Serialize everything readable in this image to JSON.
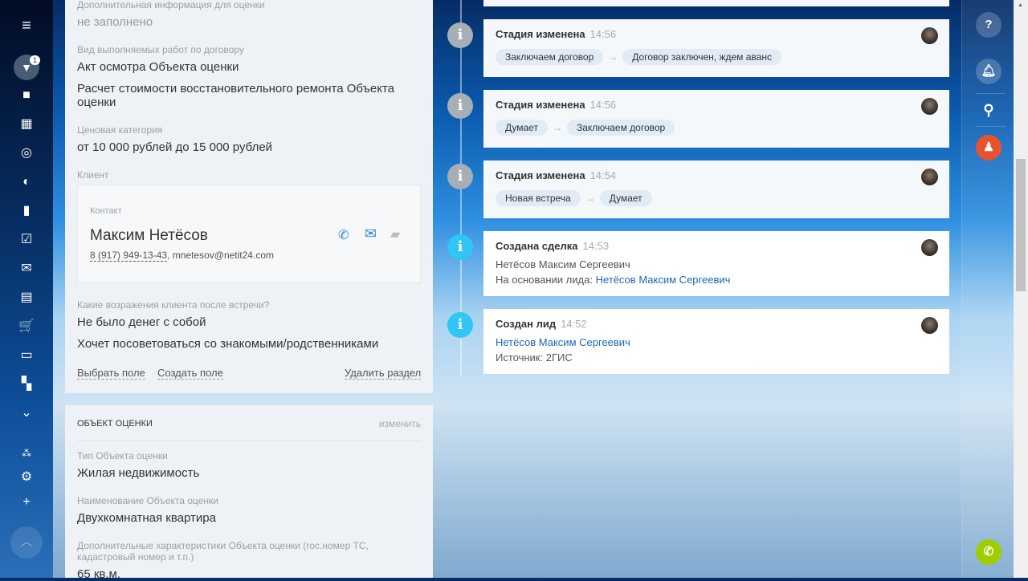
{
  "nav": {
    "badge": "1",
    "icons": [
      "menu-icon",
      "funnel-icon",
      "box-icon",
      "calendar-icon",
      "target-icon",
      "clock-icon",
      "chart-icon",
      "tasks-icon",
      "mail-icon",
      "inbox-icon",
      "cart-icon",
      "window-icon",
      "apps-icon",
      "more-icon",
      "sitemap-icon",
      "settings-icon",
      "plus-icon",
      "scroll-up-icon"
    ]
  },
  "card1": {
    "f1_label": "Дополнительная информация для оценки",
    "f1_value": "не заполнено",
    "f2_label": "Вид выполняемых работ по договору",
    "f2_value1": "Акт осмотра Объекта оценки",
    "f2_value2": "Расчет стоимости восстановительного ремонта Объекта оценки",
    "f3_label": "Ценовая категория",
    "f3_value": "от 10 000 рублей до 15 000 рублей",
    "client_label": "Клиент",
    "contact_label": "Контакт",
    "contact_name": "Максим Нетёсов",
    "contact_phone": "8 (917) 949-13-43",
    "contact_email": ", mnetesov@netit24.com",
    "f4_label": "Какие возражения клиента после встречи?",
    "f4_value1": "Не было денег с собой",
    "f4_value2": "Хочет посоветоваться со знакомыми/родственниками",
    "select_field": "Выбрать поле",
    "create_field": "Создать поле",
    "delete_section": "Удалить раздел"
  },
  "card2": {
    "title": "ОБЪЕКТ ОЦЕНКИ",
    "edit": "изменить",
    "f1_label": "Тип Объекта оценки",
    "f1_value": "Жилая недвижимость",
    "f2_label": "Наименование Объекта оценки",
    "f2_value": "Двухкомнатная квартира",
    "f3_label": "Дополнительные характеристики Объекта оценки (гос.номер ТС, кадастровый номер и т.п.)",
    "f3_value": "65 кв.м."
  },
  "timeline": [
    {
      "title": "Стадия изменена",
      "time": "14:56",
      "from": "Заключаем договор",
      "to": "Договор заключен, ждем аванс"
    },
    {
      "title": "Стадия изменена",
      "time": "14:56",
      "from": "Думает",
      "to": "Заключаем договор"
    },
    {
      "title": "Стадия изменена",
      "time": "14:54",
      "from": "Новая встреча",
      "to": "Думает"
    },
    {
      "title": "Создана сделка",
      "time": "14:53",
      "line1": "Нетёсов Максим Сергеевич",
      "line2_prefix": "На основании лида: ",
      "line2_link": "Нетёсов Максим Сергеевич"
    },
    {
      "title": "Создан лид",
      "time": "14:52",
      "link": "Нетёсов Максим Сергеевич",
      "line2": "Источник: 2ГИС"
    }
  ],
  "colors": {
    "accent": "#2067b0",
    "info_blue": "#2fc6f6",
    "user_red": "#e8532e",
    "call_green": "#9dcf00"
  }
}
